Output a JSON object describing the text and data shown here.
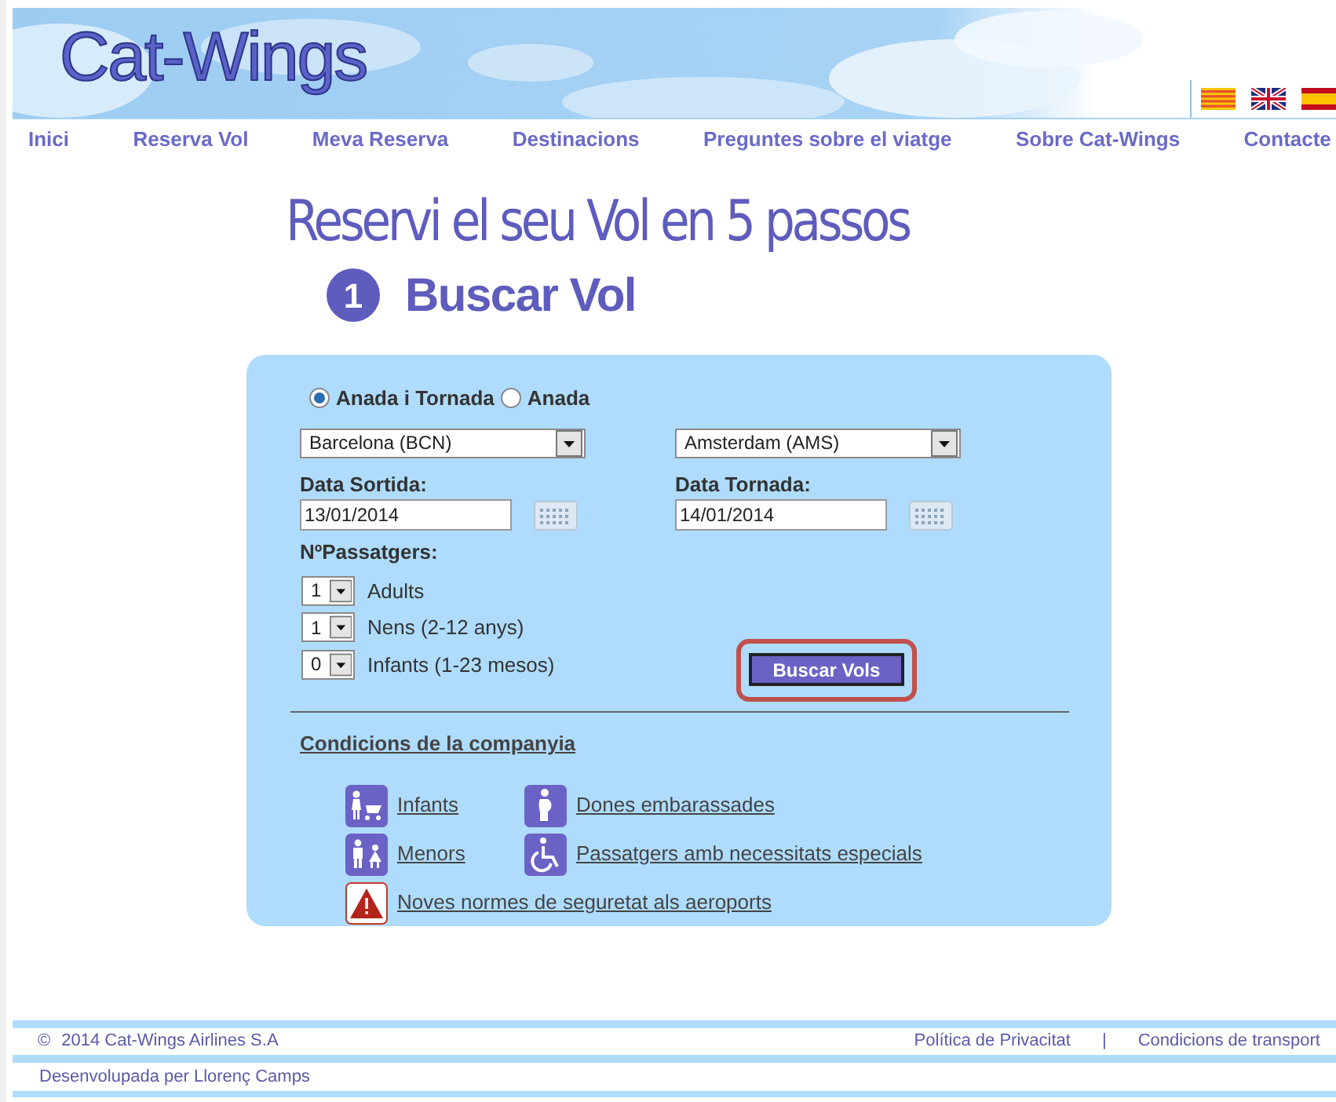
{
  "header": {
    "logo": "Cat-Wings",
    "languages": [
      {
        "kind": "catalan"
      },
      {
        "kind": "english"
      },
      {
        "kind": "spanish"
      }
    ]
  },
  "nav": {
    "items": [
      "Inici",
      "Reserva Vol",
      "Meva Reserva",
      "Destinacions",
      "Preguntes sobre el viatge",
      "Sobre Cat-Wings",
      "Contacte"
    ]
  },
  "booking": {
    "title": "Reservi el seu Vol en 5 passos",
    "step": {
      "number": "1",
      "label": "Buscar Vol"
    },
    "trip_types": [
      {
        "label": "Anada i Tornada",
        "selected": true
      },
      {
        "label": "Anada",
        "selected": false
      }
    ],
    "origin": {
      "value": "Barcelona (BCN)"
    },
    "destination": {
      "value": "Amsterdam (AMS)"
    },
    "departure": {
      "label": "Data Sortida:",
      "value": "13/01/2014"
    },
    "return": {
      "label": "Data Tornada:",
      "value": "14/01/2014"
    },
    "passengers": {
      "label": "NºPassatgers:",
      "rows": [
        {
          "count": "1",
          "label": "Adults"
        },
        {
          "count": "1",
          "label": "Nens (2-12 anys)"
        },
        {
          "count": "0",
          "label": "Infants (1-23 mesos)"
        }
      ]
    },
    "search_button": {
      "label": "Buscar Vols",
      "highlighted": true
    },
    "conditions": {
      "title": "Condicions de la companyia",
      "links": [
        {
          "kind": "infant",
          "label": "Infants"
        },
        {
          "kind": "pregnant",
          "label": "Dones embarassades"
        },
        {
          "kind": "minor",
          "label": "Menors"
        },
        {
          "kind": "wheelchair",
          "label": "Passatgers amb necessitats especials"
        },
        {
          "kind": "warning",
          "label": "Noves normes de seguretat als aeroports"
        }
      ]
    }
  },
  "footer": {
    "copyright_symbol": "©",
    "copyright": "2014 Cat-Wings Airlines S.A",
    "links": [
      "Política de Privacitat",
      "Condicions de transport"
    ],
    "separator": "|",
    "credit": "Desenvolupada per Llorenç Camps"
  }
}
